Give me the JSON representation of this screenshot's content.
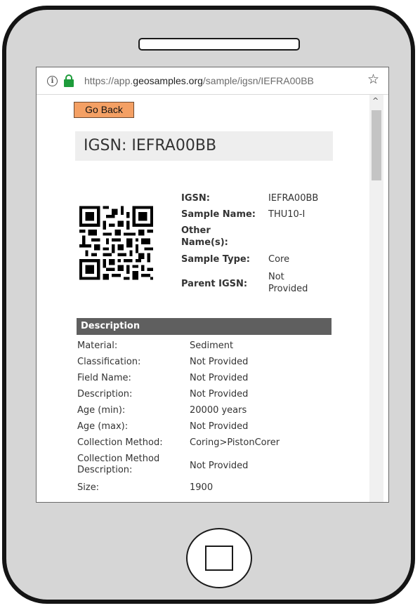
{
  "browser": {
    "url_scheme": "https://app.",
    "url_host": "geosamples.org",
    "url_path": "/sample/igsn/IEFRA00BB"
  },
  "page": {
    "go_back_label": "Go Back",
    "title": "IGSN: IEFRA00BB"
  },
  "summary": [
    {
      "label": "IGSN:",
      "value": "IEFRA00BB"
    },
    {
      "label": "Sample Name:",
      "value": "THU10-I"
    },
    {
      "label": "Other Name(s):",
      "value": ""
    },
    {
      "label": "Sample Type:",
      "value": "Core"
    },
    {
      "label": "Parent IGSN:",
      "value": "Not Provided"
    }
  ],
  "description": {
    "header": "Description",
    "rows": [
      {
        "label": "Material:",
        "value": "Sediment"
      },
      {
        "label": "Classification:",
        "value": "Not Provided"
      },
      {
        "label": "Field Name:",
        "value": "Not Provided"
      },
      {
        "label": "Description:",
        "value": "Not Provided"
      },
      {
        "label": "Age (min):",
        "value": "20000 years"
      },
      {
        "label": "Age (max):",
        "value": "Not Provided"
      },
      {
        "label": "Collection Method:",
        "value": "Coring>PistonCorer"
      },
      {
        "label": "Collection Method Description:",
        "value": "Not Provided"
      },
      {
        "label": "Size:",
        "value": "1900"
      }
    ]
  },
  "icons": {
    "info": "info-icon",
    "lock": "lock-icon",
    "star": "star-icon",
    "qr": "qr-code-icon"
  },
  "colors": {
    "go_back_bg": "#f4a064",
    "lock_green": "#1e9c3b",
    "section_header": "#5f5f5f"
  }
}
